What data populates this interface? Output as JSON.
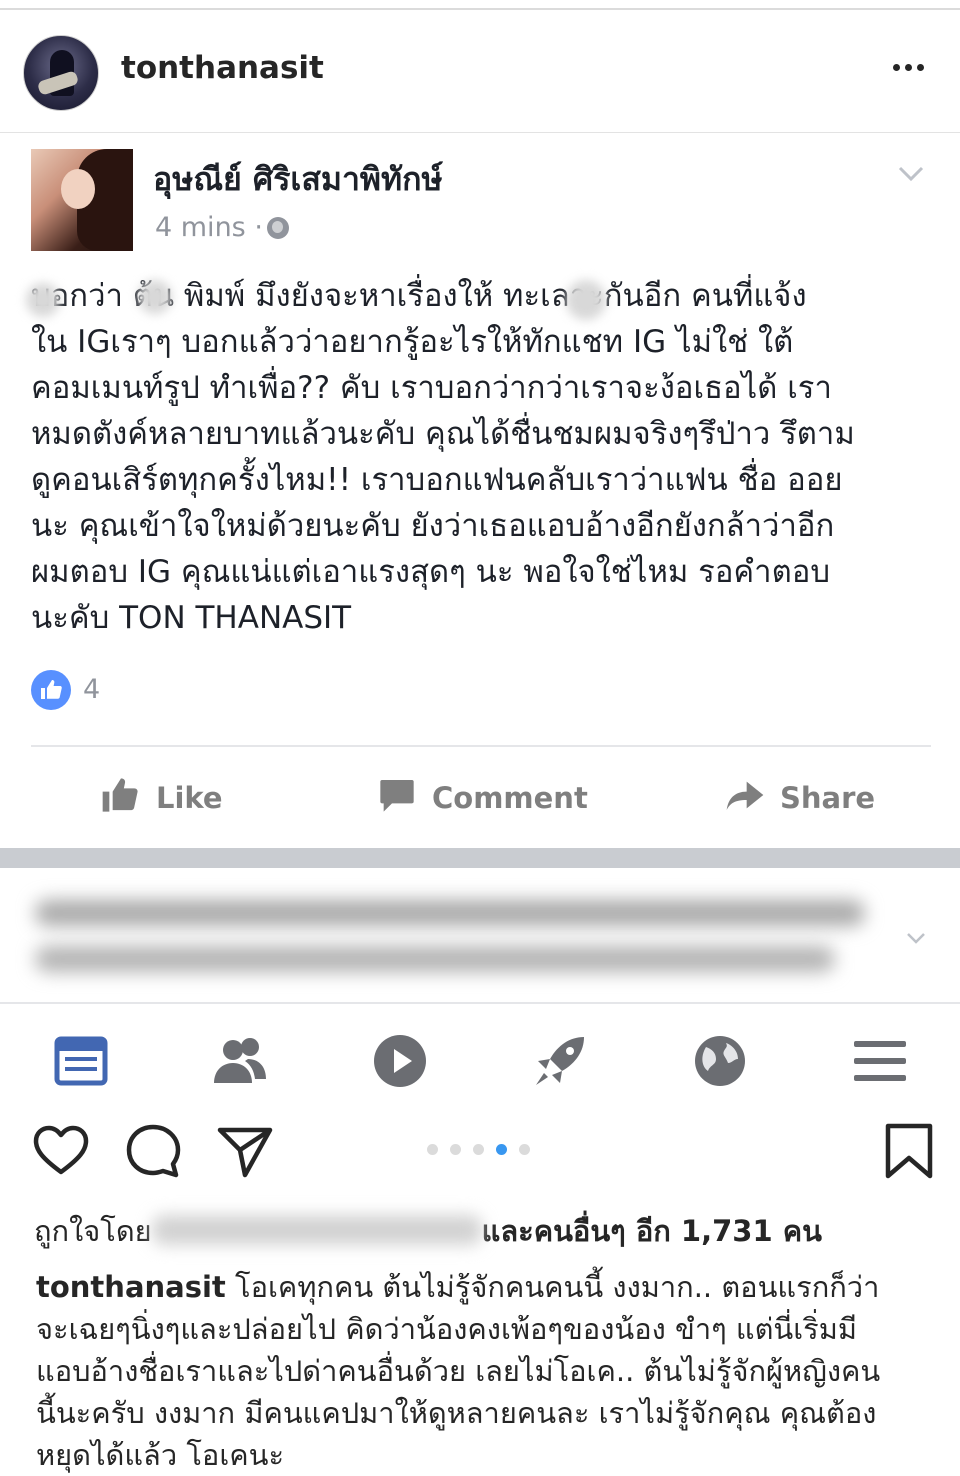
{
  "header": {
    "username": "tonthanasit"
  },
  "fb_post": {
    "author": "อุษณีย์ ศิริเสมาพิทักษ์",
    "time": "4 mins",
    "dot": "·",
    "body_lines": [
      " บอกว่า  ต้น พิมพ์ มึงยังจะหาเรื่องให้  ทะเลาะกันอีก คนที่แจ้ง",
      "ใน IGเราๆ บอกแล้วว่าอยากรู้อะไรให้ทักแชท IG ไม่ใช่ ใต้",
      "คอมเมนท์รูป ทำเพื่อ?? คับ เราบอกว่ากว่าเราจะง้อเธอได้ เรา",
      "หมดตังค์หลายบาทแล้วนะคับ คุณได้ชื่นชมผมจริงๆรึป่าว รึตาม",
      "ดูคอนเสิร์ตทุกครั้งไหม!! เราบอกแฟนคลับเราว่าแฟน ชื่อ ออย",
      "นะ คุณเข้าใจใหม่ด้วยนะคับ ยังว่าเธอแอบอ้างอีกยังกล้าว่าอีก",
      "ผมตอบ IG คุณแน่แต่เอาแรงสุดๆ นะ พอใจใช่ไหม รอคำตอบ",
      "นะคับ TON THANASIT"
    ],
    "like_count": "4",
    "actions": {
      "like": "Like",
      "comment": "Comment",
      "share": "Share"
    }
  },
  "ig_footer": {
    "carousel_total": 5,
    "carousel_active": 4,
    "likes_prefix": "ถูกใจโดย",
    "likes_suffix": "และคนอื่นๆ อีก 1,731 คน",
    "caption_user": "tonthanasit",
    "caption_lines": [
      " โอเคทุกคน ต้นไม่รู้จักคนคนนี้ งงมาก.. ตอนแรกก็ว่า",
      "จะเฉยๆนิ่งๆและปล่อยไป คิดว่าน้องคงเพ้อๆของน้อง ขำๆ แต่นี่เริ่มมี",
      "แอบอ้างชื่อเราและไปด่าคนอื่นด้วย เลยไม่โอเค.. ต้นไม่รู้จักผู้หญิงคน",
      "นี้นะครับ งงมาก มีคนแคปมาให้ดูหลายคนละ เราไม่รู้จักคุณ คุณต้อง",
      "หยุดได้แล้ว โอเคนะ"
    ]
  },
  "colors": {
    "fb_blue": "#5890ff",
    "ig_active_dot": "#3897f0",
    "fb_action_gray": "#7f7f7f"
  }
}
